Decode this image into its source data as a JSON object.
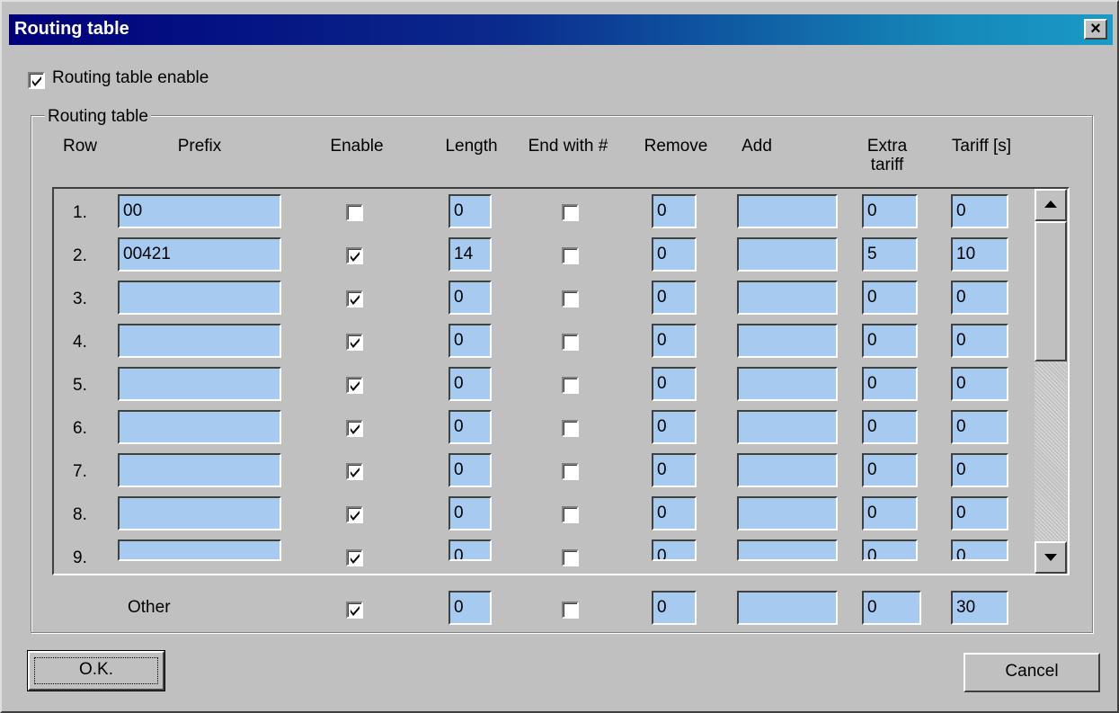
{
  "window": {
    "title": "Routing table"
  },
  "enable_checkbox": {
    "label": "Routing table enable",
    "checked": true
  },
  "group": {
    "label": "Routing table"
  },
  "headers": {
    "row": "Row",
    "prefix": "Prefix",
    "enable": "Enable",
    "length": "Length",
    "end_with_hash": "End with #",
    "remove": "Remove",
    "add": "Add",
    "extra_tariff": "Extra tariff",
    "tariff": "Tariff [s]"
  },
  "rows": [
    {
      "num": "1.",
      "prefix": "00",
      "enable": false,
      "length": "0",
      "end_hash": false,
      "remove": "0",
      "add": "",
      "extra": "0",
      "tariff": "0"
    },
    {
      "num": "2.",
      "prefix": "00421",
      "enable": true,
      "length": "14",
      "end_hash": false,
      "remove": "0",
      "add": "",
      "extra": "5",
      "tariff": "10"
    },
    {
      "num": "3.",
      "prefix": "",
      "enable": true,
      "length": "0",
      "end_hash": false,
      "remove": "0",
      "add": "",
      "extra": "0",
      "tariff": "0"
    },
    {
      "num": "4.",
      "prefix": "",
      "enable": true,
      "length": "0",
      "end_hash": false,
      "remove": "0",
      "add": "",
      "extra": "0",
      "tariff": "0"
    },
    {
      "num": "5.",
      "prefix": "",
      "enable": true,
      "length": "0",
      "end_hash": false,
      "remove": "0",
      "add": "",
      "extra": "0",
      "tariff": "0"
    },
    {
      "num": "6.",
      "prefix": "",
      "enable": true,
      "length": "0",
      "end_hash": false,
      "remove": "0",
      "add": "",
      "extra": "0",
      "tariff": "0"
    },
    {
      "num": "7.",
      "prefix": "",
      "enable": true,
      "length": "0",
      "end_hash": false,
      "remove": "0",
      "add": "",
      "extra": "0",
      "tariff": "0"
    },
    {
      "num": "8.",
      "prefix": "",
      "enable": true,
      "length": "0",
      "end_hash": false,
      "remove": "0",
      "add": "",
      "extra": "0",
      "tariff": "0"
    },
    {
      "num": "9.",
      "prefix": "",
      "enable": true,
      "length": "0",
      "end_hash": false,
      "remove": "0",
      "add": "",
      "extra": "0",
      "tariff": "0"
    }
  ],
  "other": {
    "label": "Other",
    "enable": true,
    "length": "0",
    "end_hash": false,
    "remove": "0",
    "add": "",
    "extra": "0",
    "tariff": "30"
  },
  "buttons": {
    "ok": "O.K.",
    "cancel": "Cancel"
  },
  "icons": {
    "close": "close-icon",
    "check": "checkmark-icon",
    "up": "scroll-up-arrow-icon",
    "down": "scroll-down-arrow-icon"
  },
  "colors": {
    "field_bg": "#a6caf0",
    "title_start": "#00007b",
    "title_end": "#1a9ac8",
    "face": "#c0c0c0"
  }
}
